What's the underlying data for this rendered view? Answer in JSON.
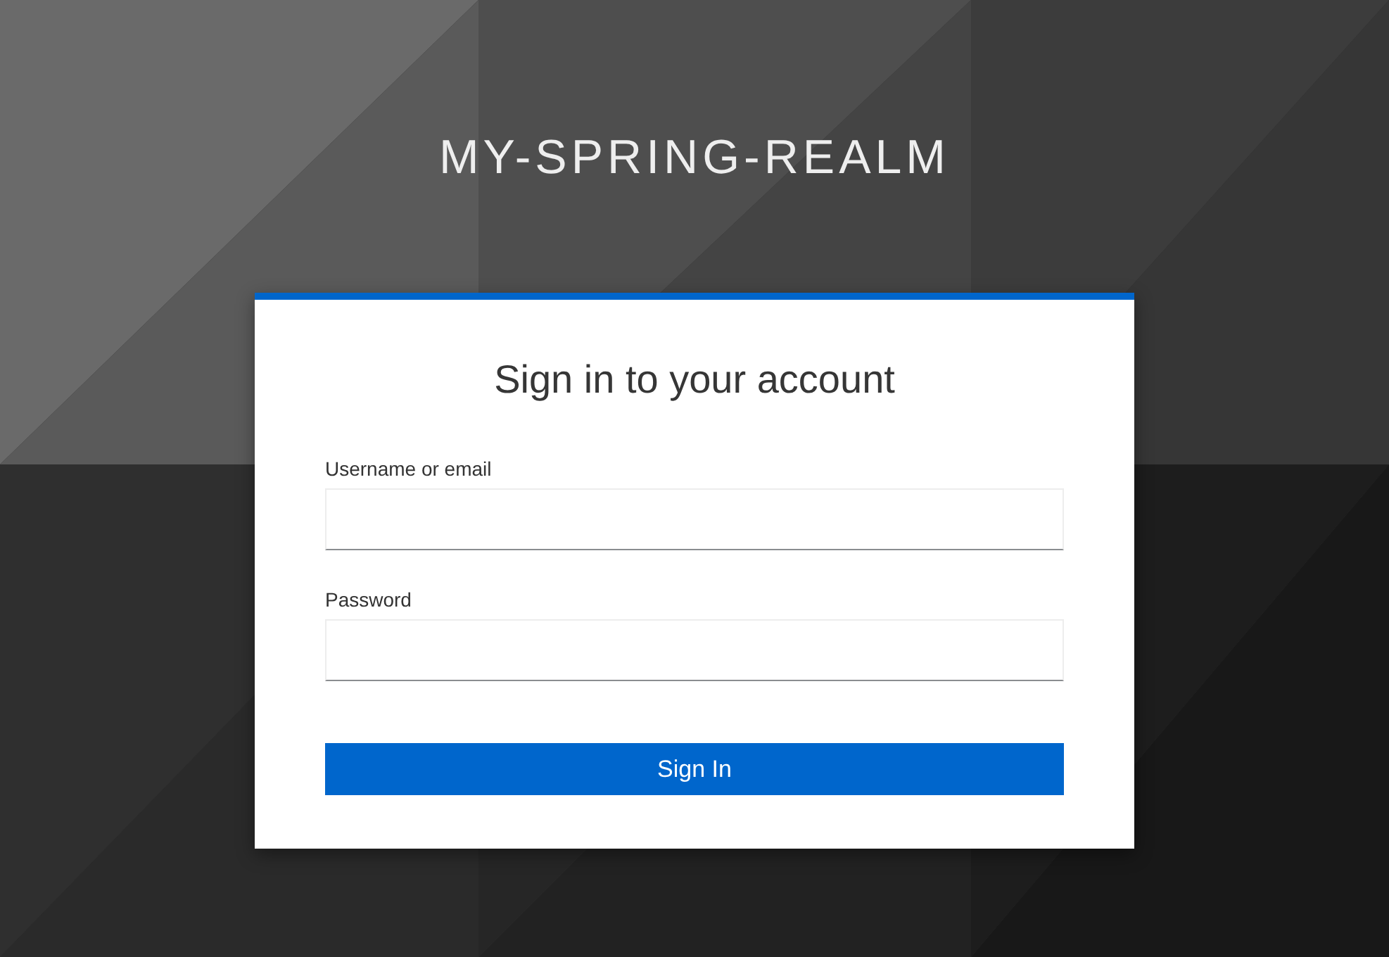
{
  "realm_title": "MY-SPRING-REALM",
  "card": {
    "title": "Sign in to your account",
    "fields": [
      {
        "label": "Username or email"
      },
      {
        "label": "Password"
      }
    ],
    "submit": "Sign In"
  }
}
